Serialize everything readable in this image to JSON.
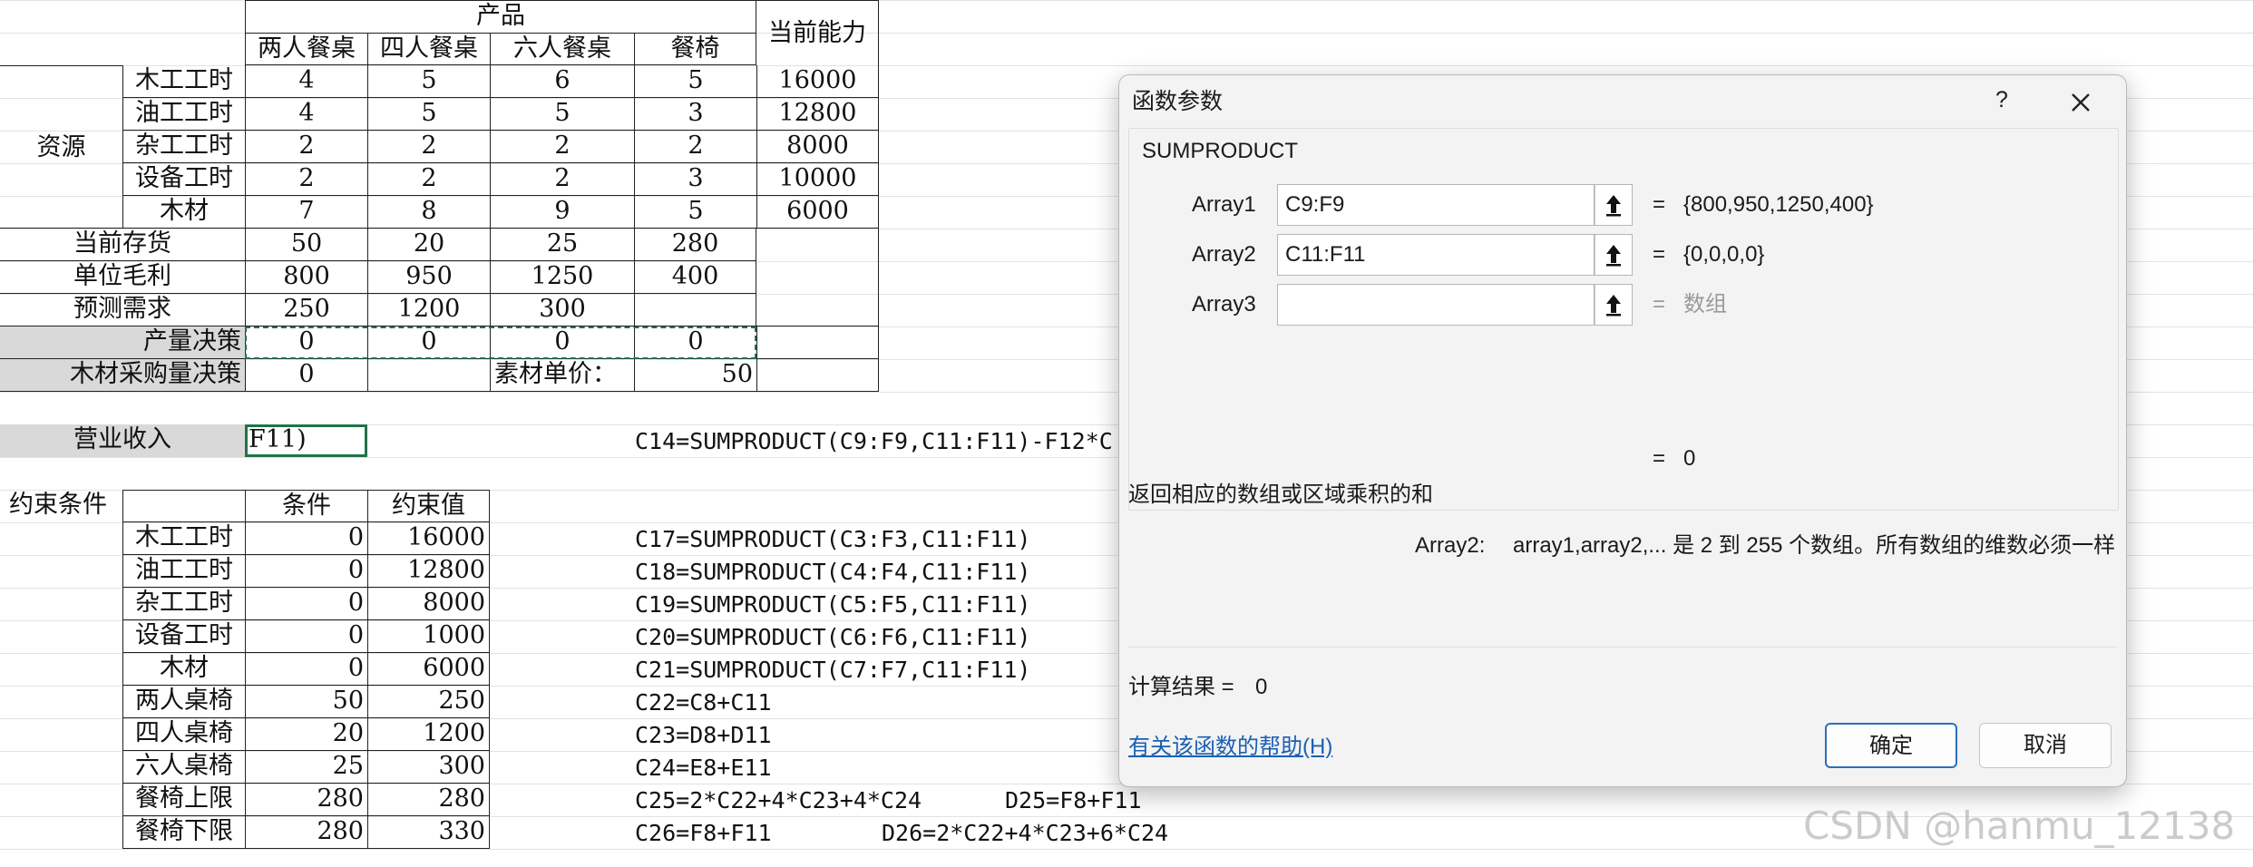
{
  "sheet": {
    "hdr_product": "产品",
    "hdr_capacity": "当前能力",
    "products": [
      "两人餐桌",
      "四人餐桌",
      "六人餐桌",
      "餐椅"
    ],
    "resource_label": "资源",
    "resources": [
      {
        "name": "木工工时",
        "v": [
          "4",
          "5",
          "6",
          "5"
        ],
        "cap": "16000"
      },
      {
        "name": "油工工时",
        "v": [
          "4",
          "5",
          "5",
          "3"
        ],
        "cap": "12800"
      },
      {
        "name": "杂工工时",
        "v": [
          "2",
          "2",
          "2",
          "2"
        ],
        "cap": "8000"
      },
      {
        "name": "设备工时",
        "v": [
          "2",
          "2",
          "2",
          "3"
        ],
        "cap": "10000"
      },
      {
        "name": "木材",
        "v": [
          "7",
          "8",
          "9",
          "5"
        ],
        "cap": "6000"
      }
    ],
    "inventory_label": "当前存货",
    "inventory": [
      "50",
      "20",
      "25",
      "280"
    ],
    "margin_label": "单位毛利",
    "margin": [
      "800",
      "950",
      "1250",
      "400"
    ],
    "demand_label": "预测需求",
    "demand": [
      "250",
      "1200",
      "300"
    ],
    "decision_label": "产量决策",
    "decision": [
      "0",
      "0",
      "0",
      "0"
    ],
    "wood_label": "木材采购量决策",
    "wood_value": "0",
    "unit_price_label": "素材单价：",
    "unit_price": "50",
    "revenue_label": "营业收入",
    "revenue_cell": "F11)",
    "revenue_formula": "C14=SUMPRODUCT(C9:F9,C11:F11)-F12*C",
    "constraints_label": "约束条件",
    "constraint_headers": [
      "条件",
      "约束值"
    ],
    "constraints": [
      {
        "name": "木工工时",
        "cond": "0",
        "limit": "16000",
        "formula": "C17=SUMPRODUCT(C3:F3,C11:F11)",
        "extra": ""
      },
      {
        "name": "油工工时",
        "cond": "0",
        "limit": "12800",
        "formula": "C18=SUMPRODUCT(C4:F4,C11:F11)",
        "extra": ""
      },
      {
        "name": "杂工工时",
        "cond": "0",
        "limit": "8000",
        "formula": "C19=SUMPRODUCT(C5:F5,C11:F11)",
        "extra": ""
      },
      {
        "name": "设备工时",
        "cond": "0",
        "limit": "1000",
        "formula": "C20=SUMPRODUCT(C6:F6,C11:F11)",
        "extra": ""
      },
      {
        "name": "木材",
        "cond": "0",
        "limit": "6000",
        "formula": "C21=SUMPRODUCT(C7:F7,C11:F11)",
        "extra": ""
      },
      {
        "name": "两人桌椅",
        "cond": "50",
        "limit": "250",
        "formula": "C22=C8+C11",
        "extra": ""
      },
      {
        "name": "四人桌椅",
        "cond": "20",
        "limit": "1200",
        "formula": "C23=D8+D11",
        "extra": ""
      },
      {
        "name": "六人桌椅",
        "cond": "25",
        "limit": "300",
        "formula": "C24=E8+E11",
        "extra": ""
      },
      {
        "name": "餐椅上限",
        "cond": "280",
        "limit": "280",
        "formula": "C25=2*C22+4*C23+4*C24",
        "extra": "D25=F8+F11"
      },
      {
        "name": "餐椅下限",
        "cond": "280",
        "limit": "330",
        "formula": "C26=F8+F11",
        "extra": "D26=2*C22+4*C23+6*C24"
      }
    ]
  },
  "dialog": {
    "title": "函数参数",
    "help_icon": "?",
    "function_name": "SUMPRODUCT",
    "args": [
      {
        "label": "Array1",
        "value": "C9:F9",
        "result": "{800,950,1250,400}",
        "placeholder": ""
      },
      {
        "label": "Array2",
        "value": "C11:F11",
        "result": "{0,0,0,0}",
        "placeholder": ""
      },
      {
        "label": "Array3",
        "value": "",
        "result": "数组",
        "placeholder": ""
      }
    ],
    "eq": "=",
    "total_result": "0",
    "description": "返回相应的数组或区域乘积的和",
    "arg_help_name": "Array2:",
    "arg_help_text": "array1,array2,... 是 2 到 255 个数组。所有数组的维数必须一样",
    "calc_label": "计算结果 =",
    "calc_value": "0",
    "help_link": "有关该函数的帮助(H)",
    "ok_label": "确定",
    "cancel_label": "取消"
  },
  "watermark": "CSDN @hanmu_12138",
  "colors": {
    "selection": "#217346",
    "link": "#1a5fb4",
    "grey_fill": "#d9d9d9"
  }
}
